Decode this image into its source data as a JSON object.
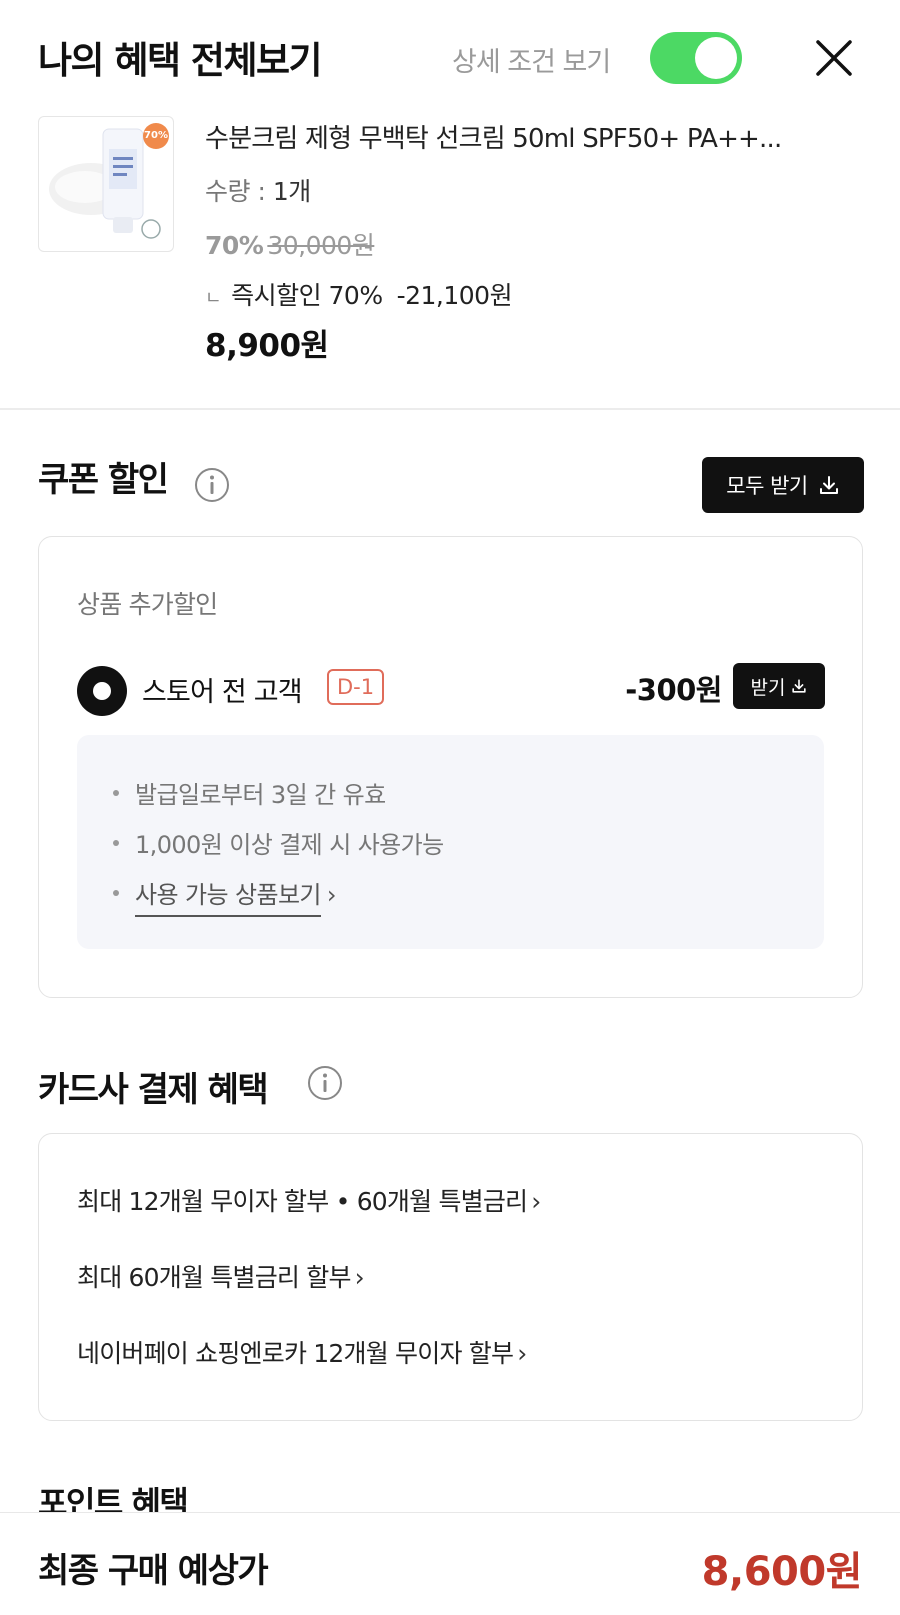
{
  "header": {
    "title": "나의 혜택 전체보기",
    "detail_toggle_label": "상세 조건 보기",
    "detail_toggle_on": true
  },
  "product": {
    "badge": "70%",
    "name": "수분크림 제형 무백탁 선크림 50ml SPF50+ PA++...",
    "qty_label": "수량 :",
    "qty_value": "1개",
    "discount_rate": "70%",
    "original_price": "30,000원",
    "instant_bracket": "ㄴ",
    "instant_label": "즉시할인 70%",
    "instant_amount": "-21,100원",
    "price": "8,900원"
  },
  "coupon": {
    "title": "쿠폰 할인",
    "receive_all_label": "모두 받기",
    "group_label": "상품 추가할인",
    "items": [
      {
        "name": "스토어 전 고객",
        "badge": "D-1",
        "amount": "-300원",
        "receive_label": "받기",
        "conditions": [
          "발급일로부터 3일 간 유효",
          "1,000원 이상 결제 시 사용가능"
        ],
        "link_label": "사용 가능 상품보기"
      }
    ]
  },
  "card_benefit": {
    "title": "카드사 결제 혜택",
    "items": [
      "최대 12개월 무이자 할부 • 60개월 특별금리",
      "최대 60개월 특별금리 할부",
      "네이버페이 쇼핑엔로카 12개월 무이자 할부"
    ]
  },
  "point": {
    "title": "포인트 혜택"
  },
  "footer": {
    "label": "최종 구매 예상가",
    "price": "8,600원"
  },
  "colors": {
    "toggle_on": "#4cd964",
    "final_price": "#c0392b",
    "dday_badge": "#e06c5a",
    "dark_button": "#111111"
  },
  "icons": [
    "close-icon",
    "info-icon",
    "download-icon",
    "chevron-right-icon",
    "radio-selected-icon"
  ]
}
